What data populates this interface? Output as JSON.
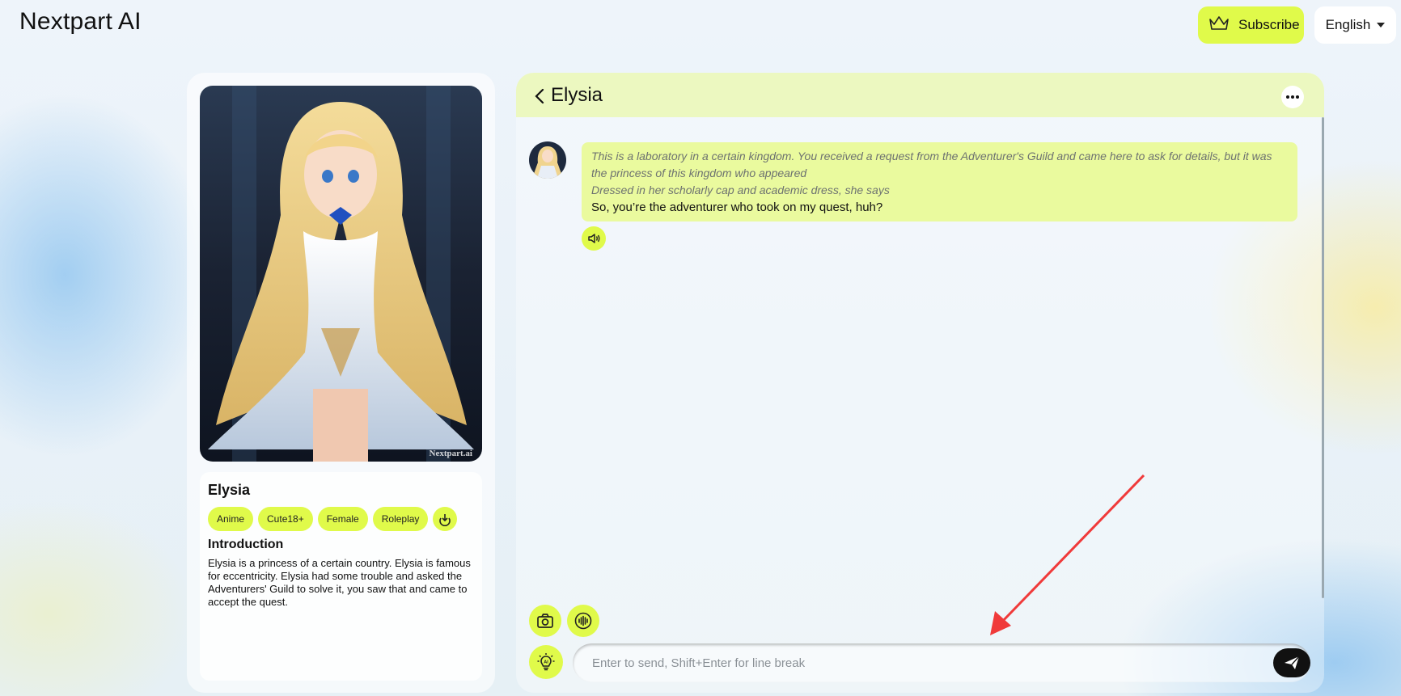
{
  "header": {
    "brand": "Nextpart AI",
    "subscribe_label": "Subscribe",
    "language": "English"
  },
  "character": {
    "name": "Elysia",
    "watermark": "Nextpart.ai",
    "tags": [
      "Anime",
      "Cute18+",
      "Female",
      "Roleplay"
    ],
    "intro_title": "Introduction",
    "intro_text": "Elysia is a princess of a certain country. Elysia is famous for eccentricity. Elysia had some trouble and asked the Adventurers' Guild to solve it, you saw that and came to accept the quest."
  },
  "chat": {
    "title": "Elysia",
    "messages": [
      {
        "narration_1": "This is a laboratory in a certain kingdom. You received a request from the Adventurer's Guild and came here to ask for details, but it was the princess of this kingdom who appeared",
        "narration_2": "Dressed in her scholarly cap and academic dress, she says",
        "speech": "So, you’re the adventurer who took on my quest, huh?"
      }
    ],
    "input_placeholder": "Enter to send, Shift+Enter for line break"
  },
  "colors": {
    "accent": "#e0fa4a",
    "header_bg": "#ecf8c0",
    "bubble_bg": "#eafa9e",
    "annotation_arrow": "#f03a3a"
  },
  "icons": [
    "crown-icon",
    "chevron-down-icon",
    "back-chevron-icon",
    "more-icon",
    "speaker-icon",
    "download-icon",
    "camera-icon",
    "voice-icon",
    "ai-lightbulb-icon",
    "send-icon"
  ]
}
